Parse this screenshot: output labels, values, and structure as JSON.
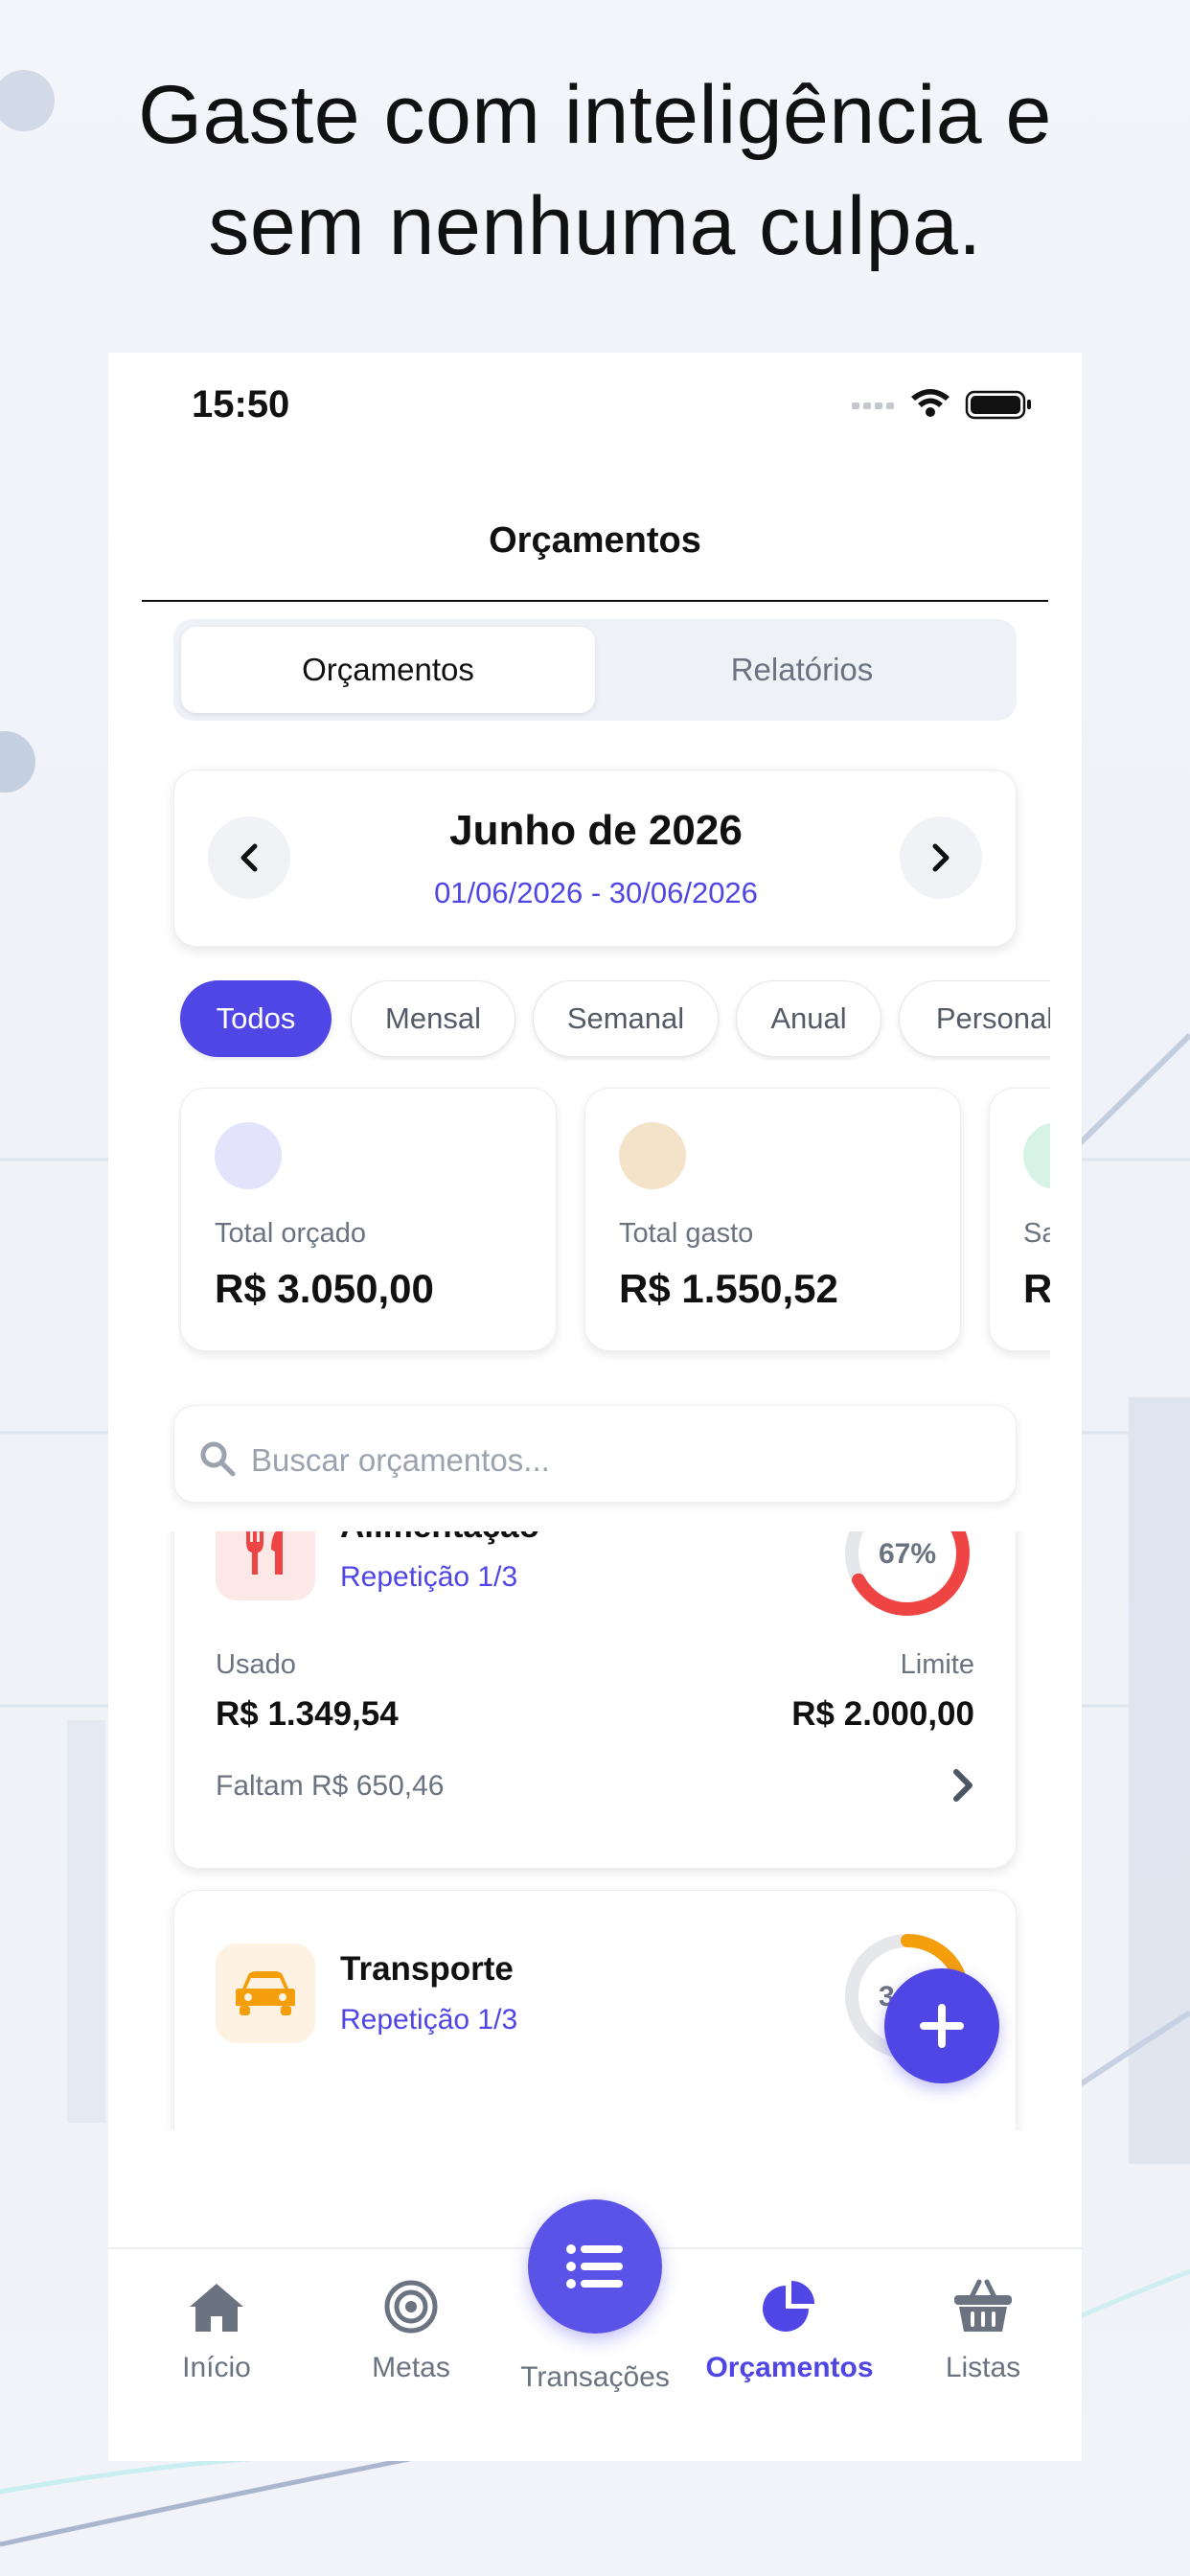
{
  "headline": {
    "line1": "Gaste com inteligência e",
    "line2": "sem nenhuma culpa."
  },
  "status_bar": {
    "time": "15:50"
  },
  "header": {
    "title": "Orçamentos"
  },
  "segmented": {
    "active": "Orçamentos",
    "inactive": "Relatórios"
  },
  "period": {
    "title": "Junho de 2026",
    "range": "01/06/2026 - 30/06/2026"
  },
  "filters": [
    "Todos",
    "Mensal",
    "Semanal",
    "Anual",
    "Personal"
  ],
  "summary": [
    {
      "label": "Total orçado",
      "value": "R$ 3.050,00",
      "color": "#e3e3fb"
    },
    {
      "label": "Total gasto",
      "value": "R$ 1.550,52",
      "color": "#f4e3c9"
    },
    {
      "label": "Sa",
      "value": "R",
      "color": "#d6f3e6"
    }
  ],
  "search": {
    "placeholder": "Buscar orçamentos..."
  },
  "budgets": [
    {
      "name": "Alimentação",
      "repetition": "Repetição 1/3",
      "percent_label": "67%",
      "percent": 0.67,
      "used_label": "Usado",
      "used_value": "R$ 1.349,54",
      "limit_label": "Limite",
      "limit_value": "R$ 2.000,00",
      "remaining": "Faltam R$ 650,46",
      "icon": "utensils-icon",
      "color": "#ef4444"
    },
    {
      "name": "Transporte",
      "repetition": "Repetição 1/3",
      "percent_label": "34%",
      "percent": 0.34,
      "icon": "car-icon",
      "color": "#f59e0b"
    }
  ],
  "tabbar": {
    "home": "Início",
    "goals": "Metas",
    "transactions": "Transações",
    "budgets": "Orçamentos",
    "lists": "Listas"
  },
  "colors": {
    "accent": "#4f46e5",
    "danger": "#ef4444",
    "warning": "#f59e0b"
  }
}
